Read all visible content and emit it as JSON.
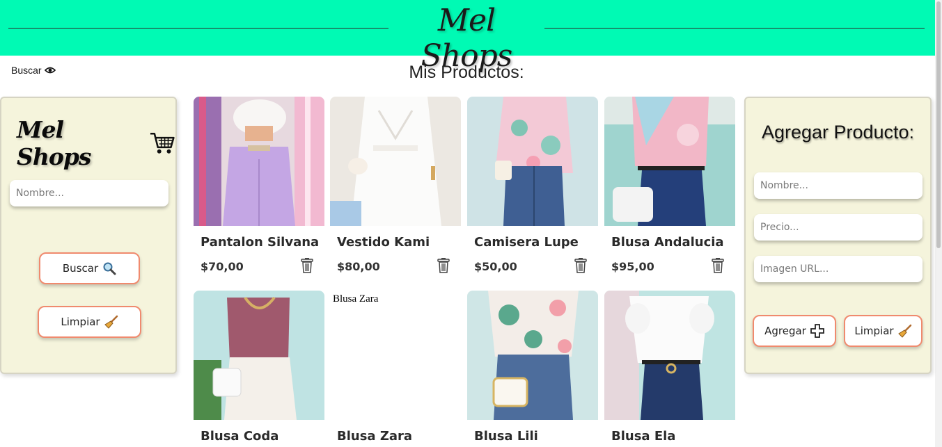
{
  "header": {
    "brand": "Mel Shops"
  },
  "toggle": {
    "label": "Buscar",
    "icon": "eye-icon"
  },
  "heading": "Mis Productos:",
  "search_panel": {
    "brand": "Mel Shops",
    "brand_icon": "shopping-cart-icon",
    "name_placeholder": "Nombre...",
    "search_label": "Buscar",
    "search_icon": "magnifier-icon",
    "clear_label": "Limpiar",
    "clear_icon": "broom-icon"
  },
  "add_panel": {
    "title": "Agregar Producto:",
    "name_placeholder": "Nombre...",
    "price_placeholder": "Precio...",
    "image_placeholder": "Imagen URL...",
    "add_label": "Agregar",
    "add_icon": "plus-icon",
    "clear_label": "Limpiar",
    "clear_icon": "broom-icon"
  },
  "products": [
    {
      "name": "Pantalon Silvana",
      "price": "$70,00"
    },
    {
      "name": "Vestido Kami",
      "price": "$80,00"
    },
    {
      "name": "Camisera Lupe",
      "price": "$50,00"
    },
    {
      "name": "Blusa Andalucia",
      "price": "$95,00"
    },
    {
      "name": "Blusa Coda"
    },
    {
      "name": "Blusa Zara",
      "alt": "Blusa Zara"
    },
    {
      "name": "Blusa Lili"
    },
    {
      "name": "Blusa Ela"
    }
  ],
  "colors": {
    "header": "#00fab4",
    "panel": "#f5f4dc",
    "button_border": "#f08a6e"
  }
}
